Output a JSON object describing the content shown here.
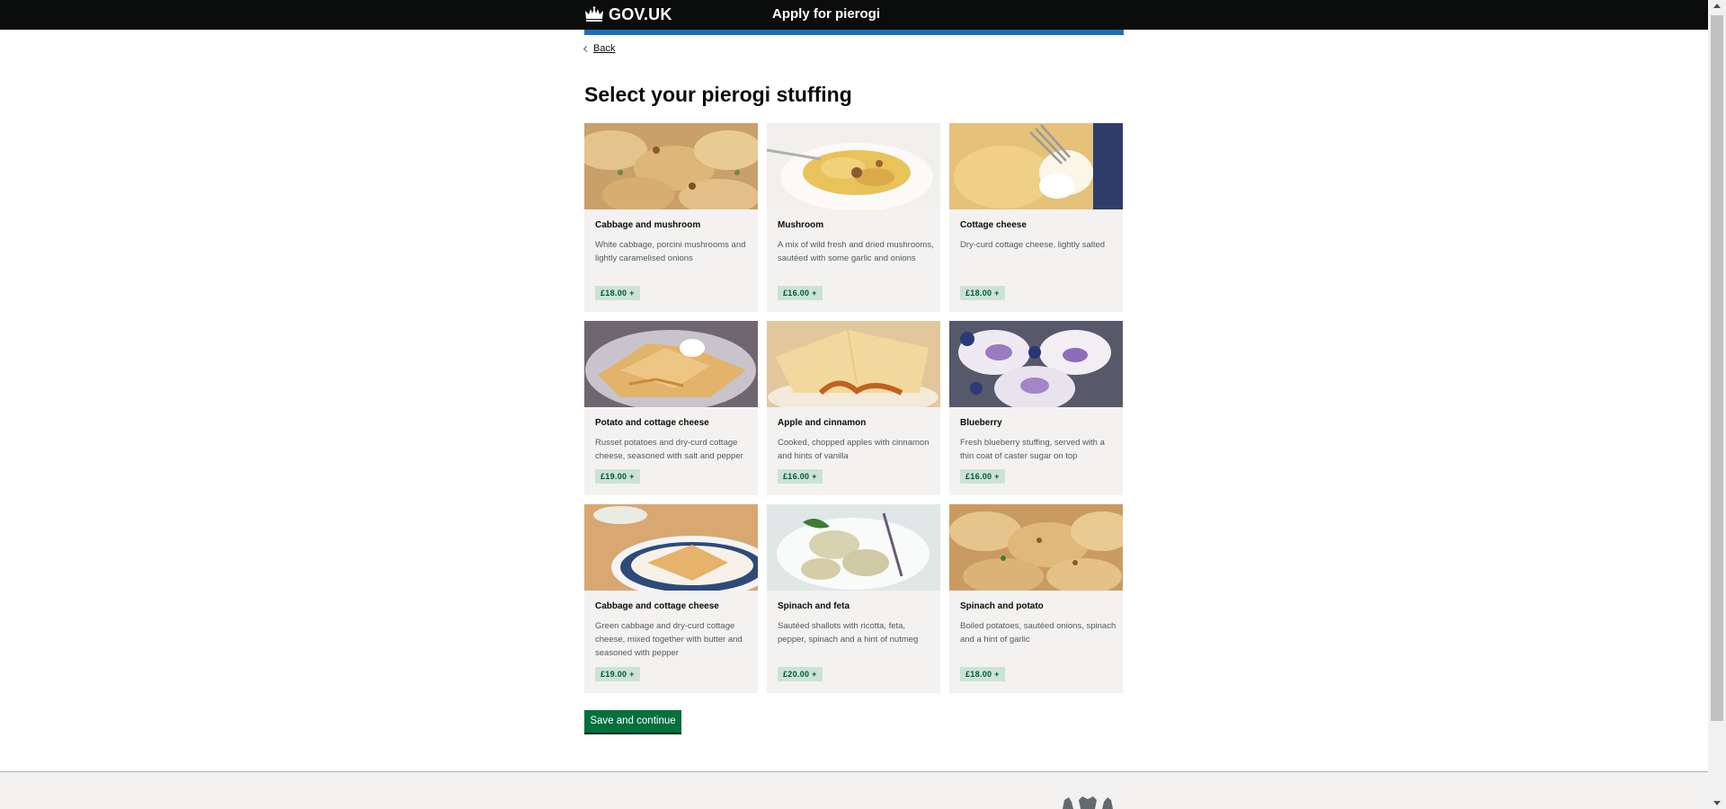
{
  "header": {
    "logo_text": "GOV.UK",
    "service_name": "Apply for pierogi"
  },
  "back_link": "Back",
  "page_title": "Select your pierogi stuffing",
  "cards": [
    {
      "title": "Cabbage and mushroom",
      "description": "White cabbage, porcini mushrooms and lightly caramelised onions",
      "price": "£18.00 +"
    },
    {
      "title": "Mushroom",
      "description": "A mix of wild fresh and dried mushrooms, sautéed with some garlic and onions",
      "price": "£16.00 +"
    },
    {
      "title": "Cottage cheese",
      "description": "Dry-curd cottage cheese, lightly salted",
      "price": "£18.00 +"
    },
    {
      "title": "Potato and cottage cheese",
      "description": "Russet potatoes and dry-curd cottage cheese, seasoned with salt and pepper",
      "price": "£19.00 +"
    },
    {
      "title": "Apple and cinnamon",
      "description": "Cooked, chopped apples with cinnamon and hints of vanilla",
      "price": "£16.00 +"
    },
    {
      "title": "Blueberry",
      "description": "Fresh blueberry stuffing, served with a thin coat of caster sugar on top",
      "price": "£16.00 +"
    },
    {
      "title": "Cabbage and cottage cheese",
      "description": "Green cabbage and dry-curd cottage cheese, mixed together with butter and seasoned with pepper",
      "price": "£19.00 +"
    },
    {
      "title": "Spinach and feta",
      "description": "Sautéed shallots with ricotta, feta, pepper, spinach and a hint of nutmeg",
      "price": "£20.00 +"
    },
    {
      "title": "Spinach and potato",
      "description": "Boiled potatoes, sautéed onions, spinach and a hint of garlic",
      "price": "£18.00 +"
    }
  ],
  "submit_button": "Save and continue",
  "icons": {
    "logo": "crown-icon",
    "back": "chevron-left-icon",
    "footer": "royal-coat-of-arms-icon"
  },
  "colors": {
    "header_bg": "#0b0c0c",
    "accent_bar": "#1d70b8",
    "button": "#00703c",
    "tag_bg": "#cce2d8",
    "tag_text": "#005a30",
    "card_bg": "#f3f2f1"
  }
}
